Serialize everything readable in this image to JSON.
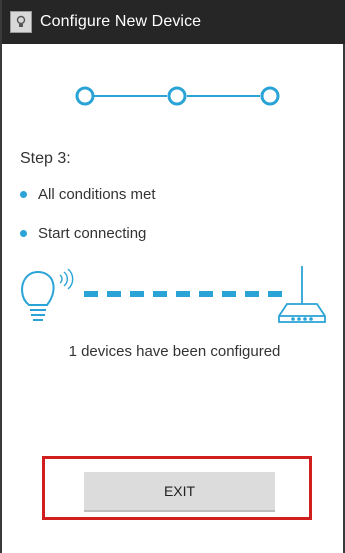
{
  "window": {
    "title": "Configure New Device",
    "app_icon": "app-icon"
  },
  "progress": {
    "total_steps": 3,
    "current_step": 3,
    "accent_color": "#2aa3d6"
  },
  "step": {
    "label": "Step 3:",
    "conditions": [
      {
        "text": "All conditions met"
      },
      {
        "text": "Start connecting"
      }
    ]
  },
  "connection": {
    "source_icon": "lightbulb-icon",
    "target_icon": "router-icon",
    "link_style": "dashed"
  },
  "status": {
    "message": "1 devices have been configured"
  },
  "actions": {
    "exit_label": "EXIT",
    "highlight_color": "#d11f1f"
  }
}
